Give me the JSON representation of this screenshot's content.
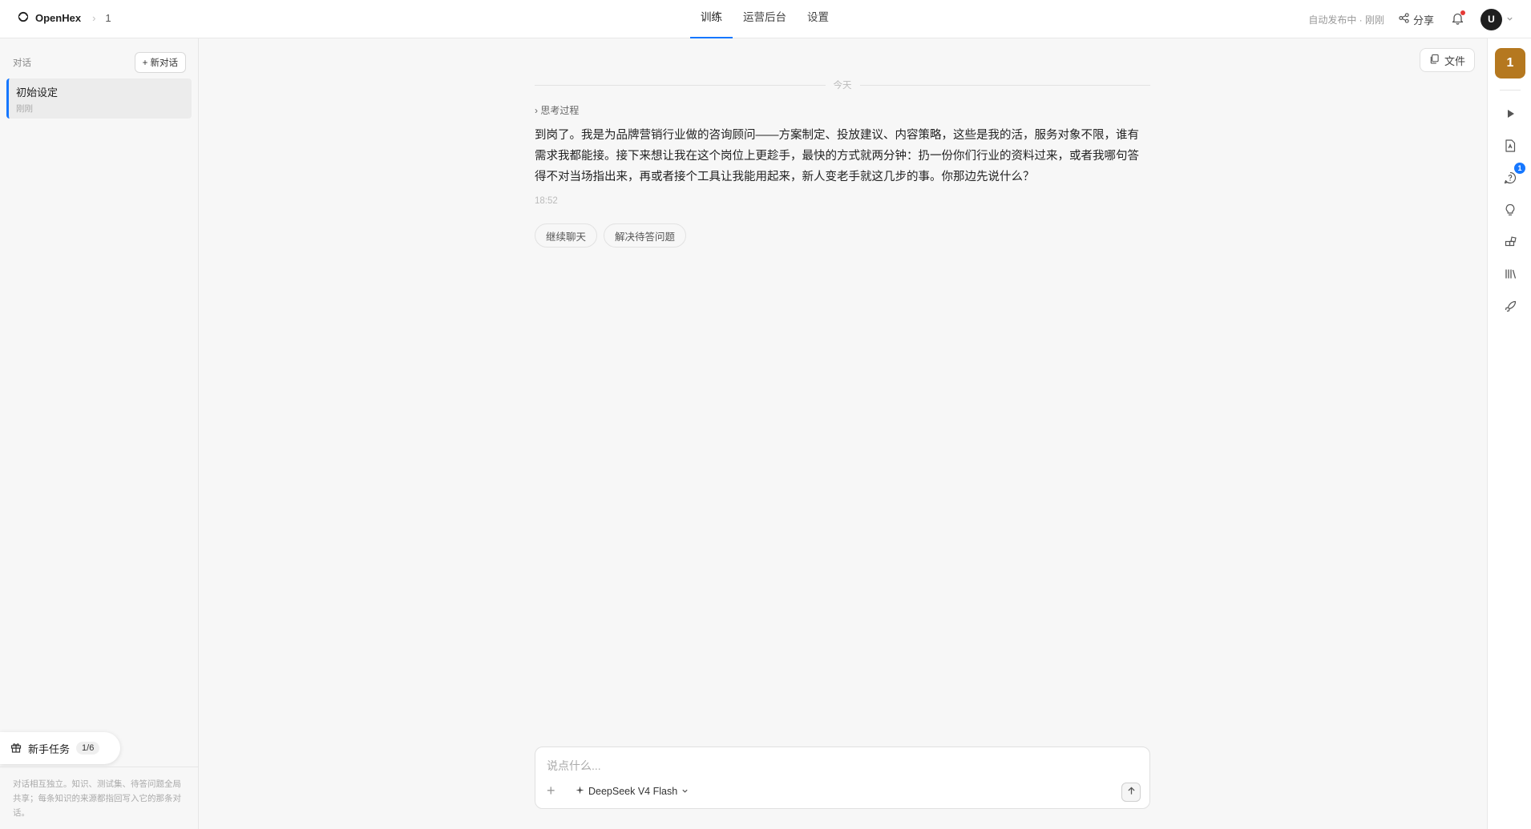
{
  "header": {
    "app_name": "OpenHex",
    "crumb_separator": "›",
    "breadcrumb": "1",
    "tabs": [
      {
        "label": "训练",
        "active": true
      },
      {
        "label": "运营后台",
        "active": false
      },
      {
        "label": "设置",
        "active": false
      }
    ],
    "publish_status": "自动发布中 · 刚刚",
    "share_label": "分享",
    "notification_dot_color": "#e53935",
    "avatar_letter": "U"
  },
  "sidebar": {
    "title": "对话",
    "new_chat_label": "+ 新对话",
    "conversations": [
      {
        "title": "初始设定",
        "time": "刚刚",
        "active": true
      }
    ],
    "tasks_label": "新手任务",
    "tasks_progress": "1/6",
    "note": "对话相互独立。知识、测试集、待答问题全局共享；每条知识的来源都指回写入它的那条对话。"
  },
  "main": {
    "files_label": "文件",
    "day_separator": "今天",
    "thinking_label": "› 思考过程",
    "message_text": "到岗了。我是为品牌营销行业做的咨询顾问——方案制定、投放建议、内容策略，这些是我的活，服务对象不限，谁有需求我都能接。接下来想让我在这个岗位上更趁手，最快的方式就两分钟：扔一份你们行业的资料过来，或者我哪句答得不对当场指出来，再或者接个工具让我能用起来，新人变老手就这几步的事。你那边先说什么？",
    "message_time": "18:52",
    "suggestions": [
      "继续聊天",
      "解决待答问题"
    ],
    "composer": {
      "placeholder": "说点什么...",
      "attach_label": "+",
      "model_name": "DeepSeek V4 Flash"
    }
  },
  "rightbar": {
    "agent_badge": "1",
    "agent_color": "#b5781f",
    "accent_color": "#1677ff",
    "questions_badge": "1",
    "icons": [
      "play-icon",
      "document-icon",
      "question-chat-icon",
      "lightbulb-icon",
      "plugin-icon",
      "library-icon",
      "rocket-icon"
    ]
  }
}
